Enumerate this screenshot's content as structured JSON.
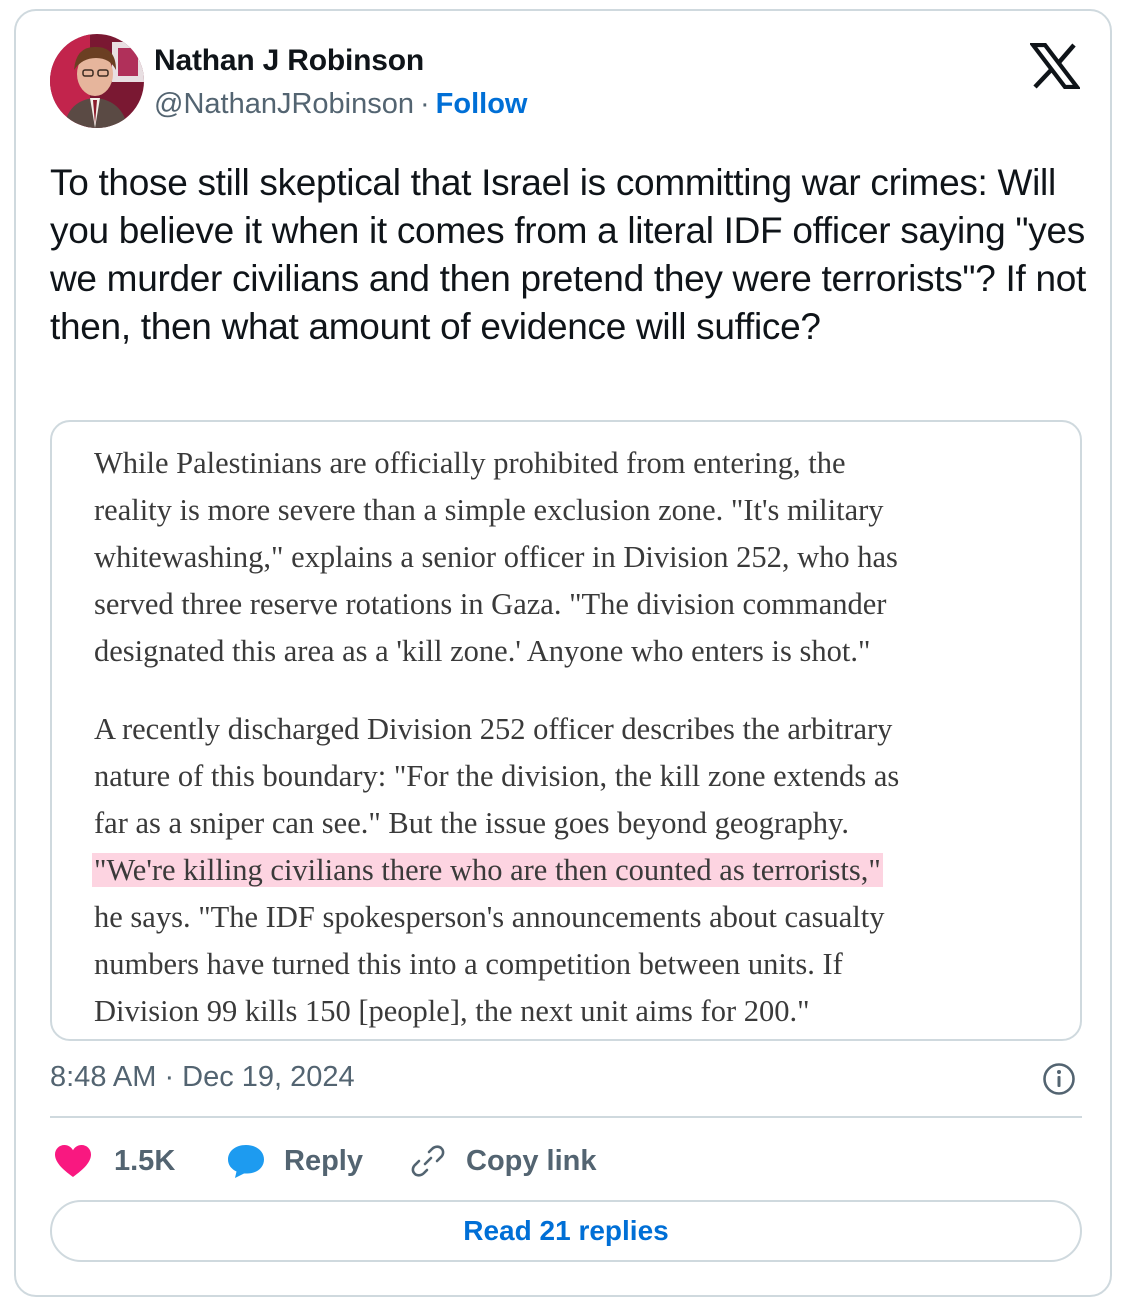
{
  "author": {
    "name": "Nathan J Robinson",
    "handle": "@NathanJRobinson",
    "separator": "·",
    "follow_label": "Follow"
  },
  "tweet": {
    "text": "To those still skeptical that Israel is committing war crimes: Will you believe it when it comes from a literal IDF officer saying \"yes we murder civilians and then pretend they were terrorists\"? If not then, then what amount of evidence will suffice?"
  },
  "media_excerpt": {
    "paragraph1": [
      "While Palestinians are officially prohibited from entering, the",
      "reality is more severe than a simple exclusion zone. \"It's military",
      "whitewashing,\" explains a senior officer in Division 252, who has",
      "served three reserve rotations in Gaza. \"The division commander",
      "designated this area as a 'kill zone.' Anyone who enters is shot.\""
    ],
    "paragraph2": [
      "A recently discharged Division 252 officer describes the arbitrary",
      "nature of this boundary: \"For the division, the kill zone extends as",
      "far as a sniper can see.\" But the issue goes beyond geography.",
      "\"We're killing civilians there who are then counted as terrorists,\"",
      "he says. \"The IDF spokesperson's announcements about casualty",
      "numbers have turned this into a competition between units. If",
      "Division 99 kills 150 [people], the next unit aims for 200.\""
    ],
    "highlight_color": "#fdd4e1"
  },
  "meta": {
    "timestamp": "8:48 AM · Dec 19, 2024"
  },
  "actions": {
    "like_count": "1.5K",
    "reply_label": "Reply",
    "copy_link_label": "Copy link",
    "read_replies_label": "Read 21 replies"
  },
  "colors": {
    "accent": "#006fd6",
    "like": "#f91880",
    "reply": "#1d9bf0",
    "text": "#0f1419",
    "muted": "#536471",
    "border": "#cfd9de"
  },
  "icons": [
    "x-logo-icon",
    "info-icon",
    "heart-icon",
    "speech-bubble-icon",
    "link-icon"
  ]
}
